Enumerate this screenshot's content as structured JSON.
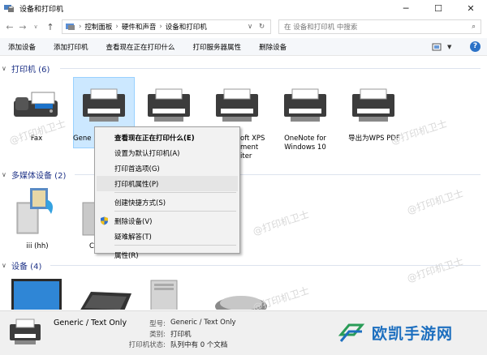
{
  "window": {
    "title": "设备和打印机"
  },
  "address": {
    "crumbs": [
      "控制面板",
      "硬件和声音",
      "设备和打印机"
    ],
    "search_placeholder": "在 设备和打印机 中搜索"
  },
  "toolbar": {
    "add_device": "添加设备",
    "add_printer": "添加打印机",
    "see_printing": "查看现在正在打印什么",
    "print_server": "打印服务器属性",
    "remove_device": "删除设备"
  },
  "groups": {
    "printers": {
      "label": "打印机 (6)"
    },
    "multimedia": {
      "label": "多媒体设备 (2)"
    },
    "devices": {
      "label": "设备 (4)"
    }
  },
  "printers": [
    {
      "label": "Fax"
    },
    {
      "label": "Gene"
    },
    {
      "label": ""
    },
    {
      "label1": "oft XPS",
      "label2": "ment",
      "label3": "iter"
    },
    {
      "label1": "OneNote for",
      "label2": "Windows 10"
    },
    {
      "label": "导出为WPS PDF"
    }
  ],
  "multimedia": [
    {
      "label": "iii (hh)"
    },
    {
      "label": "C"
    }
  ],
  "context_menu": {
    "items": [
      "查看现在正在打印什么(E)",
      "设置为默认打印机(A)",
      "打印首选项(G)",
      "打印机属性(P)",
      "创建快捷方式(S)",
      "删除设备(V)",
      "疑难解答(T)",
      "属性(R)"
    ]
  },
  "details": {
    "name": "Generic / Text Only",
    "model_label": "型号:",
    "model_value": "Generic / Text Only",
    "category_label": "类别:",
    "category_value": "打印机",
    "status_label": "打印机状态:",
    "status_value": "队列中有 0 个文档"
  },
  "watermark": "@打印机卫士",
  "brand": {
    "text": "欧凯手游网"
  },
  "colors": {
    "accent": "#1e3287",
    "selection": "#cce8ff",
    "brand": "#1d6fbf"
  }
}
